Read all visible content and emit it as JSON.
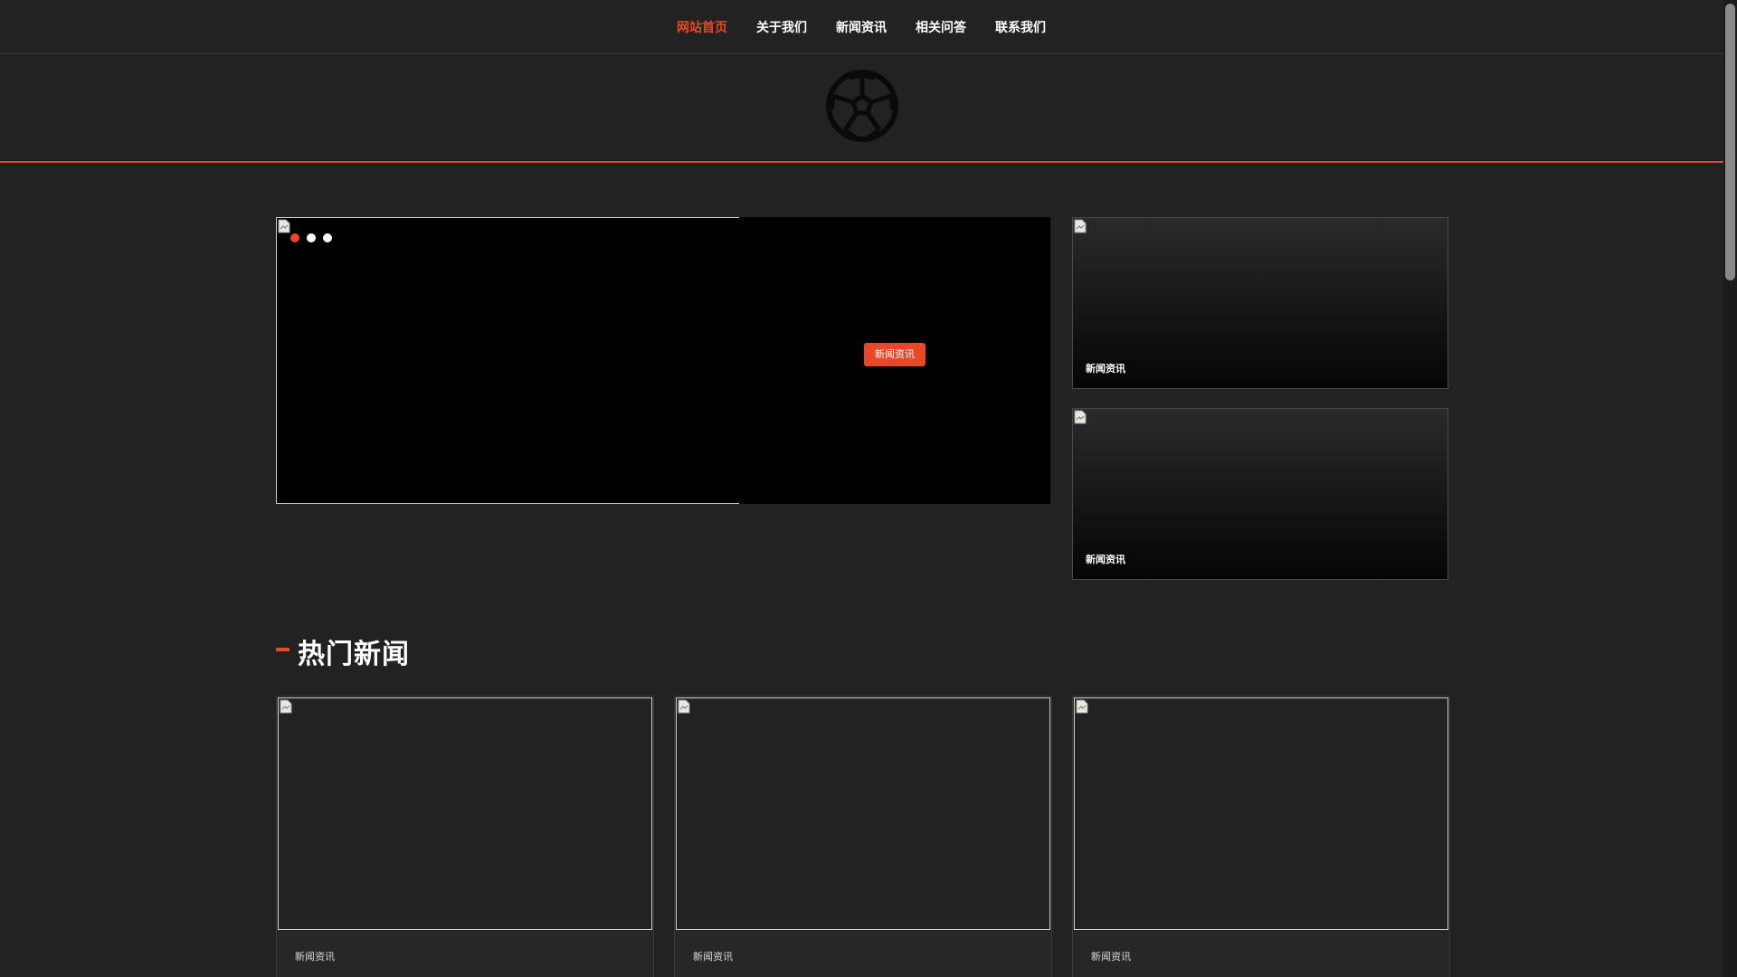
{
  "nav": {
    "items": [
      {
        "label": "网站首页",
        "active": true
      },
      {
        "label": "关于我们",
        "active": false
      },
      {
        "label": "新闻资讯",
        "active": false
      },
      {
        "label": "相关问答",
        "active": false
      },
      {
        "label": "联系我们",
        "active": false
      }
    ]
  },
  "logo": {
    "icon": "soccer-ball-icon"
  },
  "carousel": {
    "caption_tag": "新闻资讯",
    "slides": 3,
    "active_slide": 1
  },
  "side_cards": [
    {
      "label": "新闻资讯"
    },
    {
      "label": "新闻资讯"
    }
  ],
  "section": {
    "title": "热门新闻"
  },
  "news_cards": [
    {
      "label": "新闻资讯"
    },
    {
      "label": "新闻资讯"
    },
    {
      "label": "新闻资讯"
    }
  ],
  "colors": {
    "accent": "#e8472a",
    "background": "#222222"
  }
}
